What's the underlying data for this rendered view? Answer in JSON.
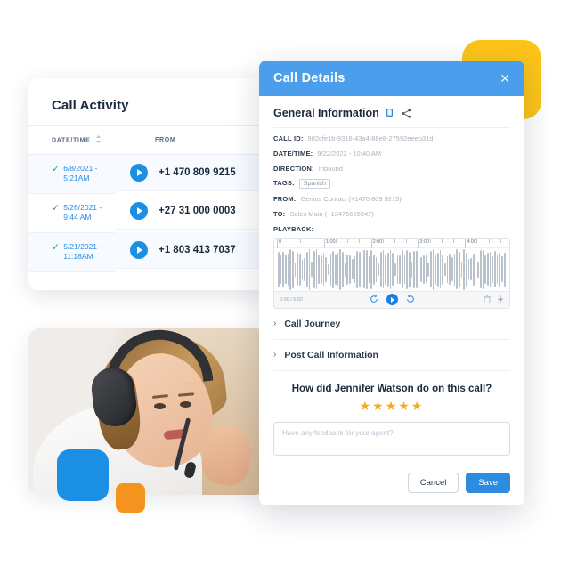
{
  "call_activity": {
    "title": "Call Activity",
    "columns": [
      "DATE/TIME",
      "FROM"
    ],
    "rows": [
      {
        "status_icon": "check-icon",
        "date": "6/8/2021 -",
        "time": "5:21AM",
        "play_icon": "play-icon",
        "number": "+1 470 809 9215"
      },
      {
        "status_icon": "check-icon",
        "date": "5/26/2021 -",
        "time": "9:44 AM",
        "play_icon": "play-icon",
        "number": "+27 31 000 0003"
      },
      {
        "status_icon": "check-icon",
        "date": "5/21/2021 -",
        "time": "11:18AM",
        "play_icon": "play-icon",
        "number": "+1 803 413 7037"
      }
    ]
  },
  "modal": {
    "title": "Call Details",
    "close_icon": "close-icon",
    "section": {
      "title": "General Information",
      "copy_icon": "copy-icon",
      "share_icon": "share-icon"
    },
    "fields": [
      {
        "key": "CALL ID:",
        "value": "982cfe1b-9316-43a4-88e8-27592eeeb31d"
      },
      {
        "key": "DATE/TIME:",
        "value": "9/22/2022 - 10:40 AM"
      },
      {
        "key": "DIRECTION:",
        "value": "Inbound"
      },
      {
        "key": "TAGS:",
        "value": "Spanish",
        "is_tag": true
      },
      {
        "key": "FROM:",
        "value": "Genius Contact (+1470 809 9215)"
      },
      {
        "key": "TO:",
        "value": "Sales Main (+13475655947)"
      }
    ],
    "playback": {
      "label": "PLAYBACK:",
      "ruler_labels": [
        "0",
        "1:00",
        "2:00",
        "3:00",
        "4:00"
      ],
      "time_display": "0:00 / 5:02",
      "rewind_icon": "rewind-icon",
      "play_icon": "play-icon",
      "forward_icon": "forward-icon",
      "delete_icon": "trash-icon",
      "download_icon": "download-icon"
    },
    "collapsibles": [
      {
        "chevron_icon": "chevron-right-icon",
        "label": "Call Journey"
      },
      {
        "chevron_icon": "chevron-right-icon",
        "label": "Post Call Information"
      }
    ],
    "rating": {
      "question": "How did Jennifer Watson do on this call?",
      "stars_filled": 5,
      "star_icon": "star-icon",
      "feedback_placeholder": "Have any feedback for your agent?",
      "feedback_value": ""
    },
    "footer": {
      "cancel_label": "Cancel",
      "save_label": "Save"
    }
  },
  "colors": {
    "header_blue": "#4a9eeb",
    "accent_blue": "#1a8fe3",
    "save_blue": "#2b8ce0",
    "yellow": "#fcc419",
    "orange": "#f5931f",
    "star_gold": "#f5ab1a",
    "check_green": "#2fb344"
  }
}
